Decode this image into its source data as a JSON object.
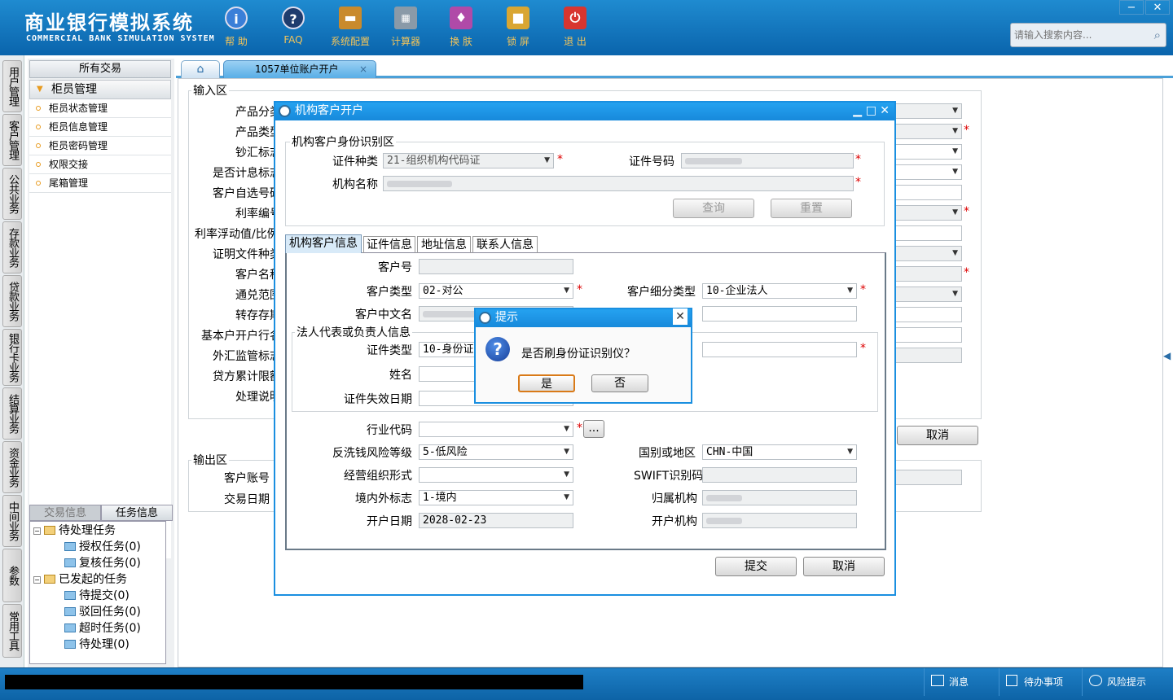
{
  "app": {
    "title_cn": "商业银行模拟系统",
    "title_en": "COMMERCIAL BANK SIMULATION SYSTEM"
  },
  "toolbar": [
    {
      "icon": "info-icon",
      "label": "帮 助",
      "color": "#3a7fd8"
    },
    {
      "icon": "faq-icon",
      "label": "FAQ",
      "color": "#1e3c6e"
    },
    {
      "icon": "toolbox-icon",
      "label": "系统配置",
      "color": "#c98a2c"
    },
    {
      "icon": "calculator-icon",
      "label": "计算器",
      "color": "#8a9aa8"
    },
    {
      "icon": "shirt-icon",
      "label": "换 肤",
      "color": "#b04aa8"
    },
    {
      "icon": "lock-icon",
      "label": "锁 屏",
      "color": "#d9a632"
    },
    {
      "icon": "power-icon",
      "label": "退 出",
      "color": "#d8352f"
    }
  ],
  "window_controls": {
    "minimize": "−",
    "close": "✕"
  },
  "search": {
    "placeholder": "请输入搜索内容..."
  },
  "vertical_nav": [
    "用户管理",
    "客户管理",
    "公共业务",
    "存款业务",
    "贷款业务",
    "银行卡业务",
    "结算业务",
    "资金业务",
    "中间业务",
    "参数",
    "常用工具"
  ],
  "left_panel": {
    "header": "所有交易",
    "group": "柜员管理",
    "items": [
      "柜员状态管理",
      "柜员信息管理",
      "柜员密码管理",
      "权限交接",
      "尾箱管理"
    ],
    "tabs": [
      "交易信息",
      "任务信息"
    ],
    "tree": [
      {
        "label": "待处理任务",
        "children": [
          "授权任务(0)",
          "复核任务(0)"
        ]
      },
      {
        "label": "已发起的任务",
        "children": [
          "待提交(0)",
          "驳回任务(0)",
          "超时任务(0)",
          "待处理(0)"
        ]
      }
    ]
  },
  "main_tabs": {
    "home_icon": "home-icon",
    "active": "1057单位账户开户"
  },
  "bg_form": {
    "input_section": "输入区",
    "labels": [
      "产品分类",
      "产品类型",
      "钞汇标志",
      "是否计息标志",
      "客户自选号码",
      "利率编号",
      "利率浮动值/比例",
      "证明文件种类",
      "客户名称",
      "通兑范围",
      "转存存期",
      "基本户开户行名",
      "外汇监管标志",
      "贷方累计限额",
      "处理说明"
    ],
    "cancel": "取消",
    "output_section": "输出区",
    "output_labels": [
      "客户账号",
      "交易日期"
    ]
  },
  "dialog": {
    "title": "机构客户开户",
    "id_section": "机构客户身份识别区",
    "id_type_label": "证件种类",
    "id_type_value": "21-组织机构代码证",
    "id_no_label": "证件号码",
    "org_name_label": "机构名称",
    "query": "查询",
    "reset": "重置",
    "tabs": [
      "机构客户信息",
      "证件信息",
      "地址信息",
      "联系人信息"
    ],
    "customer_no_label": "客户号",
    "customer_type_label": "客户类型",
    "customer_type_value": "02-对公",
    "customer_subtype_label": "客户细分类型",
    "customer_subtype_value": "10-企业法人",
    "cn_name_label": "客户中文名",
    "legal_section": "法人代表或负责人信息",
    "legal_id_type_label": "证件类型",
    "legal_id_type_value": "10-身份证",
    "legal_name_label": "姓名",
    "legal_expiry_label": "证件失效日期",
    "industry_label": "行业代码",
    "industry_btn": "...",
    "aml_label": "反洗钱风险等级",
    "aml_value": "5-低风险",
    "country_label": "国别或地区",
    "country_value": "CHN-中国",
    "org_form_label": "经营组织形式",
    "swift_label": "SWIFT识别码",
    "domestic_label": "境内外标志",
    "domestic_value": "1-境内",
    "belong_org_label": "归属机构",
    "open_date_label": "开户日期",
    "open_date_value": "2028-02-23",
    "open_org_label": "开户机构",
    "submit": "提交",
    "cancel": "取消"
  },
  "prompt": {
    "title": "提示",
    "message": "是否刷身份证识别仪？",
    "yes": "是",
    "no": "否"
  },
  "status": {
    "messages": "消息",
    "todo": "待办事项",
    "risk": "风险提示"
  }
}
